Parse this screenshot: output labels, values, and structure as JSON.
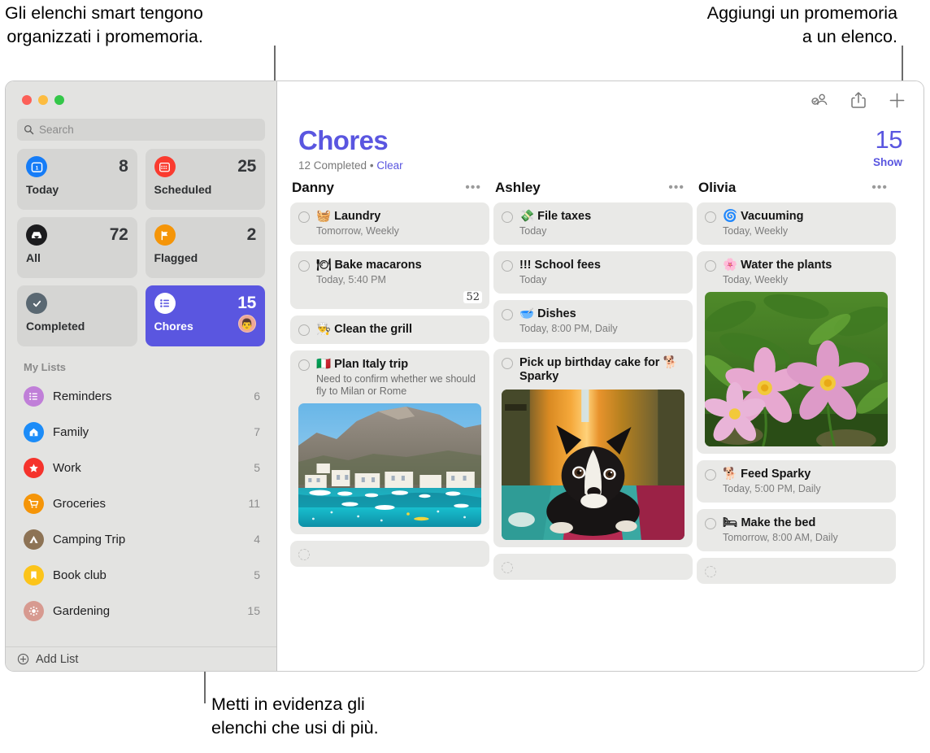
{
  "annotations": {
    "top_left": "Gli elenchi smart tengono\norganizzati i promemoria.",
    "top_right": "Aggiungi un promemoria\na un elenco.",
    "bottom": "Metti in evidenza gli\nelenchi che usi di più."
  },
  "colors": {
    "accent": "#5a56e0",
    "sidebar_bg": "#e3e3e1",
    "card_bg": "#e9e9e7",
    "smart_card_bg": "#d5d5d3"
  },
  "window": {
    "traffic_lights": [
      "close",
      "minimize",
      "zoom"
    ]
  },
  "sidebar": {
    "search": {
      "placeholder": "Search",
      "value": "",
      "icon": "search-icon"
    },
    "smart_lists": [
      {
        "label": "Today",
        "count": "8",
        "icon": "today-calendar-icon",
        "icon_color": "#157cf7",
        "glyph": "1",
        "active": false
      },
      {
        "label": "Scheduled",
        "count": "25",
        "icon": "scheduled-calendar-icon",
        "icon_color": "#fa3b2f",
        "glyph": "▦",
        "active": false
      },
      {
        "label": "All",
        "count": "72",
        "icon": "inbox-tray-icon",
        "icon_color": "#1c1c1e",
        "glyph": "▣",
        "active": false
      },
      {
        "label": "Flagged",
        "count": "2",
        "icon": "flag-icon",
        "icon_color": "#f59508",
        "glyph": "⚑",
        "active": false
      },
      {
        "label": "Completed",
        "count": "",
        "icon": "checkmark-circle-icon",
        "icon_color": "#5a6872",
        "glyph": "✓",
        "active": false
      },
      {
        "label": "Chores",
        "count": "15",
        "icon": "list-bullet-icon",
        "icon_color": "#ffffff",
        "glyph": "☰",
        "active": true,
        "avatar": "👨"
      }
    ],
    "my_lists_header": "My Lists",
    "lists": [
      {
        "name": "Reminders",
        "count": "6",
        "icon": "list-bullet-icon",
        "color": "#c07fd8",
        "glyph": "☰"
      },
      {
        "name": "Family",
        "count": "7",
        "icon": "house-icon",
        "color": "#1c8cf8",
        "glyph": "⌂"
      },
      {
        "name": "Work",
        "count": "5",
        "icon": "star-icon",
        "color": "#f5332c",
        "glyph": "★"
      },
      {
        "name": "Groceries",
        "count": "11",
        "icon": "cart-icon",
        "color": "#f59508",
        "glyph": "🛒"
      },
      {
        "name": "Camping Trip",
        "count": "4",
        "icon": "tent-icon",
        "color": "#8d7355",
        "glyph": "▲"
      },
      {
        "name": "Book club",
        "count": "5",
        "icon": "bookmark-icon",
        "color": "#fcc41a",
        "glyph": "🔖"
      },
      {
        "name": "Gardening",
        "count": "15",
        "icon": "sun-flower-icon",
        "color": "#d79a90",
        "glyph": "✺"
      }
    ],
    "add_list": {
      "label": "Add List",
      "icon": "plus-circle-icon"
    }
  },
  "main": {
    "toolbar": [
      {
        "name": "collaborate-icon",
        "label": "Collaborate"
      },
      {
        "name": "share-icon",
        "label": "Share"
      },
      {
        "name": "add-reminder-icon",
        "label": "Add"
      }
    ],
    "title": "Chores",
    "completed_text": "12 Completed",
    "separator": "•",
    "clear_label": "Clear",
    "count": "15",
    "show_label": "Show",
    "columns": [
      {
        "name": "Danny",
        "more": "•••",
        "reminders": [
          {
            "emoji": "🧺",
            "title": "Laundry",
            "sub": "Tomorrow, Weekly"
          },
          {
            "emoji": "🍽",
            "title": "Bake macarons",
            "sub": "Today, 5:40 PM",
            "badge": "52"
          },
          {
            "emoji": "👨‍🍳",
            "title": "Clean the grill",
            "sub": ""
          },
          {
            "emoji": "🇮🇹",
            "title": "Plan Italy trip",
            "note": "Need to confirm whether we should fly to Milan or Rome",
            "photo": "italy-coastline-photo"
          },
          {
            "empty": true
          }
        ]
      },
      {
        "name": "Ashley",
        "more": "•••",
        "reminders": [
          {
            "emoji": "💸",
            "title": "File taxes",
            "sub": "Today"
          },
          {
            "emoji": "",
            "title": "!!! School fees",
            "sub": "Today"
          },
          {
            "emoji": "🥣",
            "title": "Dishes",
            "sub": "Today, 8:00 PM, Daily"
          },
          {
            "emoji": "",
            "title": "Pick up birthday cake for 🐕 Sparky",
            "photo": "boston-terrier-dog-photo"
          },
          {
            "empty": true
          }
        ]
      },
      {
        "name": "Olivia",
        "more": "•••",
        "reminders": [
          {
            "emoji": "🌀",
            "title": "Vacuuming",
            "sub": "Today, Weekly"
          },
          {
            "emoji": "🌸",
            "title": "Water the plants",
            "sub": "Today, Weekly",
            "photo": "pink-cosmos-flowers-photo"
          },
          {
            "emoji": "🐕",
            "title": "Feed Sparky",
            "sub": "Today, 5:00 PM, Daily"
          },
          {
            "emoji": "🛏",
            "title": "Make the bed",
            "sub": "Tomorrow, 8:00 AM, Daily"
          },
          {
            "empty": true
          }
        ]
      }
    ]
  }
}
